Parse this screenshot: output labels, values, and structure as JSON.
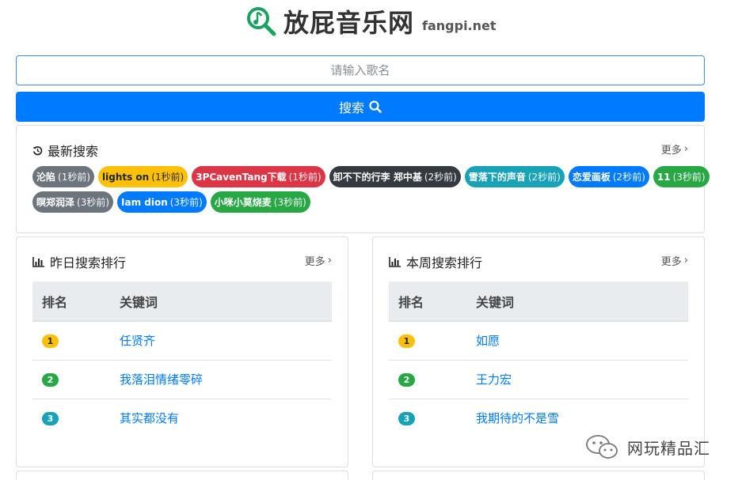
{
  "brand": {
    "name": "放屁音乐网",
    "domain": "fangpi.net",
    "logo_icon": "music-search-icon",
    "logo_color": "#1aa260"
  },
  "search": {
    "placeholder": "请输入歌名",
    "value": "",
    "button_label": "搜索",
    "button_icon": "search-icon",
    "button_color": "#007bff"
  },
  "recent": {
    "title": "最新搜索",
    "icon": "history-icon",
    "more_label": "更多",
    "rows": [
      [
        {
          "keyword": "沦陷",
          "ago": "(1秒前)",
          "color": "#6c757d",
          "text": "#ffffff"
        },
        {
          "keyword": "lights on",
          "ago": "(1秒前)",
          "color": "#ffc107",
          "text": "#212529"
        },
        {
          "keyword": "3PCavenTang下载",
          "ago": "(1秒前)",
          "color": "#dc3545",
          "text": "#ffffff"
        },
        {
          "keyword": "卸不下的行李 郑中基",
          "ago": "(2秒前)",
          "color": "#343a40",
          "text": "#ffffff"
        },
        {
          "keyword": "雪落下的声音",
          "ago": "(2秒前)",
          "color": "#17a2b8",
          "text": "#ffffff"
        },
        {
          "keyword": "恋爱画板",
          "ago": "(2秒前)",
          "color": "#007bff",
          "text": "#ffffff"
        },
        {
          "keyword": "11",
          "ago": "(3秒前)",
          "color": "#28a745",
          "text": "#ffffff"
        }
      ],
      [
        {
          "keyword": "瞑郑润泽",
          "ago": "(3秒前)",
          "color": "#6c757d",
          "text": "#ffffff"
        },
        {
          "keyword": "Iam dion",
          "ago": "(3秒前)",
          "color": "#007bff",
          "text": "#ffffff"
        },
        {
          "keyword": "小咪小莫烧麦",
          "ago": "(3秒前)",
          "color": "#28a745",
          "text": "#ffffff"
        }
      ]
    ]
  },
  "yesterday": {
    "title": "昨日搜索排行",
    "icon": "bar-chart-icon",
    "more_label": "更多",
    "col_rank": "排名",
    "col_keyword": "关键词",
    "rows": [
      {
        "rank": "1",
        "keyword": "任贤齐",
        "color": "#ffc107",
        "text": "#212529"
      },
      {
        "rank": "2",
        "keyword": "我落泪情绪零碎",
        "color": "#28a745",
        "text": "#ffffff"
      },
      {
        "rank": "3",
        "keyword": "其实都没有",
        "color": "#17a2b8",
        "text": "#ffffff"
      }
    ]
  },
  "week": {
    "title": "本周搜索排行",
    "icon": "bar-chart-icon",
    "more_label": "更多",
    "col_rank": "排名",
    "col_keyword": "关键词",
    "rows": [
      {
        "rank": "1",
        "keyword": "如愿",
        "color": "#ffc107",
        "text": "#212529"
      },
      {
        "rank": "2",
        "keyword": "王力宏",
        "color": "#28a745",
        "text": "#ffffff"
      },
      {
        "rank": "3",
        "keyword": "我期待的不是雪",
        "color": "#17a2b8",
        "text": "#ffffff"
      }
    ]
  },
  "watermark": {
    "text": "网玩精品汇",
    "icon": "wechat-icon"
  }
}
